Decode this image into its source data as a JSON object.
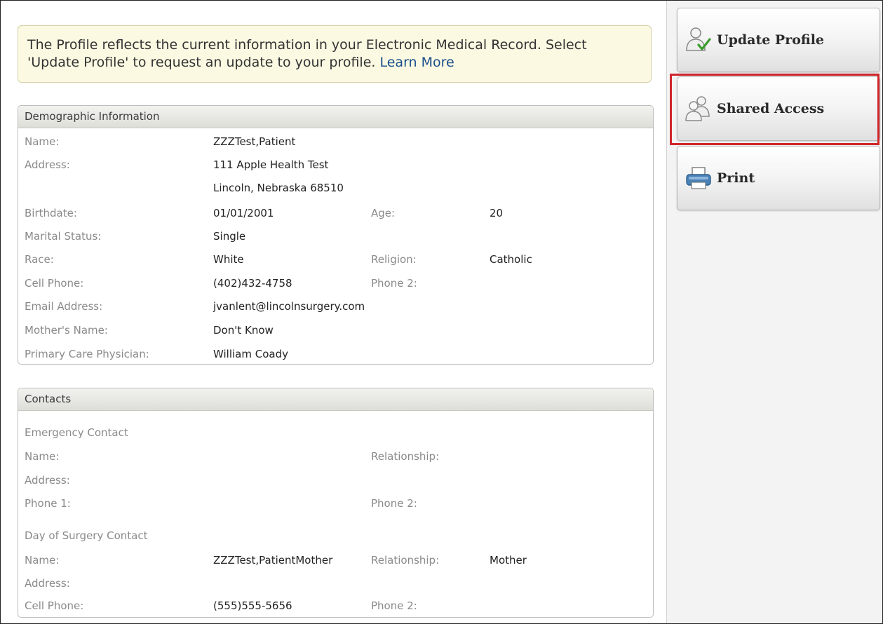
{
  "notice": {
    "text": "The Profile reflects the current information in your Electronic Medical Record. Select 'Update Profile' to request an update to your profile.",
    "link": "Learn More"
  },
  "demographics": {
    "header": "Demographic Information",
    "name_label": "Name:",
    "name_value": "ZZZTest,Patient",
    "address_label": "Address:",
    "address_line1": "111 Apple Health Test",
    "address_line2": "Lincoln, Nebraska 68510",
    "birthdate_label": "Birthdate:",
    "birthdate_value": "01/01/2001",
    "age_label": "Age:",
    "age_value": "20",
    "marital_label": "Marital Status:",
    "marital_value": "Single",
    "race_label": "Race:",
    "race_value": "White",
    "religion_label": "Religion:",
    "religion_value": "Catholic",
    "cell_label": "Cell Phone:",
    "cell_value": "(402)432-4758",
    "phone2_label": "Phone 2:",
    "phone2_value": "",
    "email_label": "Email Address:",
    "email_value": "jvanlent@lincolnsurgery.com",
    "mother_label": "Mother's Name:",
    "mother_value": "Don't Know",
    "pcp_label": "Primary Care Physician:",
    "pcp_value": "William Coady"
  },
  "contacts": {
    "header": "Contacts",
    "emergency": {
      "title": "Emergency Contact",
      "name_label": "Name:",
      "name_value": "",
      "relationship_label": "Relationship:",
      "relationship_value": "",
      "address_label": "Address:",
      "phone1_label": "Phone 1:",
      "phone2_label": "Phone 2:"
    },
    "surgery": {
      "title": "Day of Surgery Contact",
      "name_label": "Name:",
      "name_value": "ZZZTest,PatientMother",
      "relationship_label": "Relationship:",
      "relationship_value": "Mother",
      "address_label": "Address:",
      "cell_label": "Cell Phone:",
      "cell_value": "(555)555-5656",
      "phone2_label": "Phone 2:"
    }
  },
  "sidebar": {
    "update_profile": {
      "label": "Update Profile",
      "icon": "user-check-icon"
    },
    "shared_access": {
      "label": "Shared Access",
      "icon": "users-icon"
    },
    "print": {
      "label": "Print",
      "icon": "printer-icon"
    }
  },
  "colors": {
    "notice_bg": "#fbf9e2",
    "link": "#1a4f8c",
    "highlight": "#d0262b"
  }
}
